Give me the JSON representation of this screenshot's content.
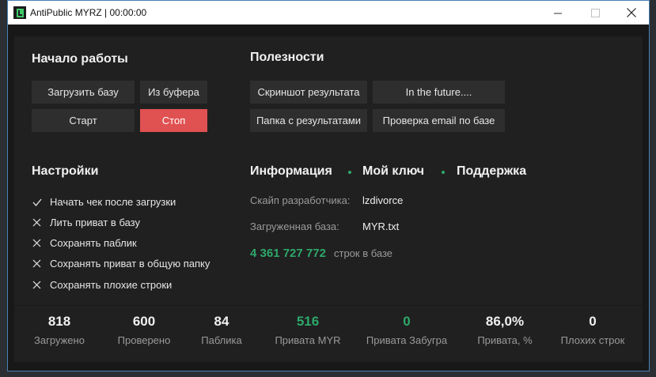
{
  "window": {
    "title": "AntiPublic MYRZ | 00:00:00"
  },
  "sections": {
    "start": "Начало работы",
    "useful": "Полезности",
    "settings": "Настройки",
    "info": "Информация",
    "my_key": "Мой ключ",
    "support": "Поддержка"
  },
  "buttons": {
    "load_base": "Загрузить базу",
    "from_clipboard": "Из буфера",
    "start": "Старт",
    "stop": "Стоп",
    "screenshot": "Скриншот результата",
    "future": "In the future....",
    "results_folder": "Папка с результатами",
    "check_email": "Проверка email по базе"
  },
  "settings": [
    {
      "label": "Начать чек после загрузки",
      "checked": true
    },
    {
      "label": "Лить приват в базу",
      "checked": false
    },
    {
      "label": "Сохранять паблик",
      "checked": false
    },
    {
      "label": "Сохранять приват в общую папку",
      "checked": false
    },
    {
      "label": "Сохранять плохие строки",
      "checked": false
    }
  ],
  "info": {
    "skype_label": "Скайп разработчика:",
    "skype_value": "lzdivorce",
    "base_label": "Загруженная база:",
    "base_value": "MYR.txt",
    "lines_count": "4 361 727 772",
    "lines_label": "строк в базе"
  },
  "stats": [
    {
      "value": "818",
      "label": "Загружено",
      "accent": false
    },
    {
      "value": "600",
      "label": "Проверено",
      "accent": false
    },
    {
      "value": "84",
      "label": "Паблика",
      "accent": false
    },
    {
      "value": "516",
      "label": "Привата MYR",
      "accent": true
    },
    {
      "value": "0",
      "label": "Привата Забугра",
      "accent": true
    },
    {
      "value": "86,0%",
      "label": "Привата, %",
      "accent": false
    },
    {
      "value": "0",
      "label": "Плохих строк",
      "accent": false
    }
  ],
  "colors": {
    "accent_green": "#2ea86a",
    "stop_red": "#e05151",
    "panel": "#202020",
    "window_bg": "#181818"
  },
  "icons": {
    "app": "app-logo-icon",
    "checked": "checkmark-icon",
    "unchecked": "cross-icon",
    "minimize": "minimize-icon",
    "maximize": "maximize-icon",
    "close": "close-icon"
  }
}
